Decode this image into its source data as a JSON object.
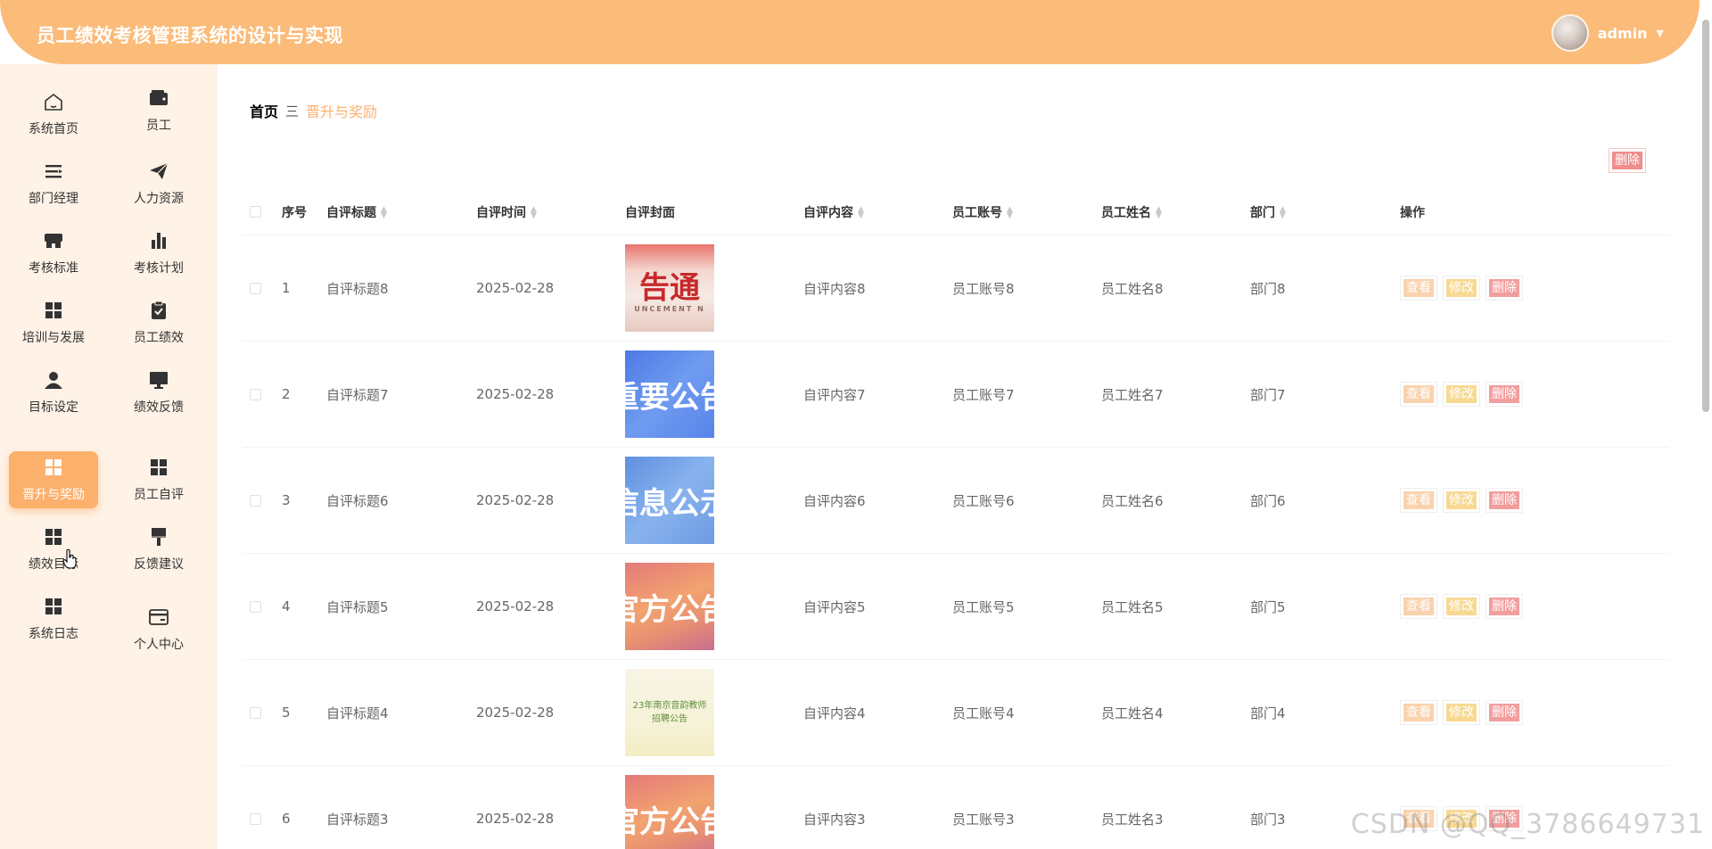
{
  "header": {
    "app_title": "员工绩效考核管理系统的设计与实现",
    "username": "admin",
    "caret": "▼"
  },
  "sidebar": {
    "items": [
      {
        "label": "系统首页",
        "icon": "home-icon"
      },
      {
        "label": "员工",
        "icon": "wallet-icon"
      },
      {
        "label": "部门经理",
        "icon": "list-icon"
      },
      {
        "label": "人力资源",
        "icon": "send-icon"
      },
      {
        "label": "考核标准",
        "icon": "shop-icon"
      },
      {
        "label": "考核计划",
        "icon": "bar-chart-icon"
      },
      {
        "label": "培训与发展",
        "icon": "grid-icon"
      },
      {
        "label": "员工绩效",
        "icon": "clipboard-check-icon"
      },
      {
        "label": "目标设定",
        "icon": "user-icon"
      },
      {
        "label": "绩效反馈",
        "icon": "monitor-icon"
      },
      {
        "label": "晋升与奖励",
        "icon": "grid-icon",
        "active": true
      },
      {
        "label": "员工自评",
        "icon": "grid-icon"
      },
      {
        "label": "绩效目标",
        "icon": "grid-icon"
      },
      {
        "label": "反馈建议",
        "icon": "brush-icon"
      },
      {
        "label": "系统日志",
        "icon": "grid-icon"
      },
      {
        "label": "个人中心",
        "icon": "card-icon"
      }
    ],
    "active_color": "#fbb06c"
  },
  "breadcrumb": {
    "home": "首页",
    "separator": "三",
    "current": "晋升与奖励"
  },
  "toolbar": {
    "delete_label": "删除"
  },
  "table": {
    "columns": [
      "序号",
      "自评标题",
      "自评时间",
      "自评封面",
      "自评内容",
      "员工账号",
      "员工姓名",
      "部门",
      "操作"
    ],
    "rows": [
      {
        "idx": "1",
        "title": "自评标题8",
        "time": "2025-02-28",
        "cover_text": "告通",
        "cover_sub": "UNCEMENT N",
        "content": "自评内容8",
        "account": "员工账号8",
        "name": "员工姓名8",
        "dept": "部门8"
      },
      {
        "idx": "2",
        "title": "自评标题7",
        "time": "2025-02-28",
        "cover_text": "重要公告",
        "content": "自评内容7",
        "account": "员工账号7",
        "name": "员工姓名7",
        "dept": "部门7"
      },
      {
        "idx": "3",
        "title": "自评标题6",
        "time": "2025-02-28",
        "cover_text": "信息公示",
        "content": "自评内容6",
        "account": "员工账号6",
        "name": "员工姓名6",
        "dept": "部门6"
      },
      {
        "idx": "4",
        "title": "自评标题5",
        "time": "2025-02-28",
        "cover_text": "官方公告",
        "content": "自评内容5",
        "account": "员工账号5",
        "name": "员工姓名5",
        "dept": "部门5"
      },
      {
        "idx": "5",
        "title": "自评标题4",
        "time": "2025-02-28",
        "cover_text": "23年南京音韵教师",
        "cover_sub": "招聘公告",
        "content": "自评内容4",
        "account": "员工账号4",
        "name": "员工姓名4",
        "dept": "部门4"
      },
      {
        "idx": "6",
        "title": "自评标题3",
        "time": "2025-02-28",
        "cover_text": "官方公告",
        "content": "自评内容3",
        "account": "员工账号3",
        "name": "员工姓名3",
        "dept": "部门3"
      }
    ],
    "actions": {
      "view": "查看",
      "edit": "修改",
      "delete": "删除"
    }
  },
  "watermark": "CSDN @QQ_3786649731"
}
